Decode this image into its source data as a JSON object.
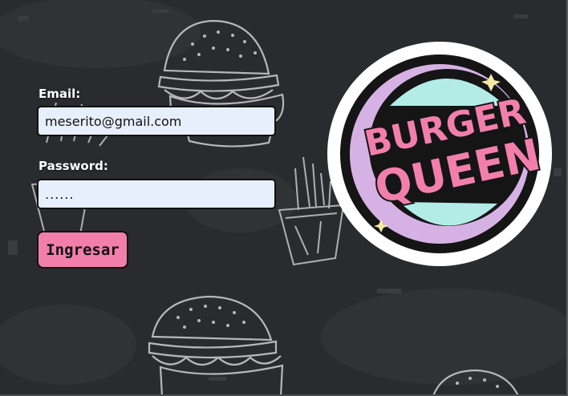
{
  "form": {
    "email_label": "Email:",
    "email_value": "meserito@gmail.com",
    "password_label": "Password:",
    "password_value": "......",
    "submit_label": "Ingresar"
  },
  "logo": {
    "line1": "BURGER",
    "line2": "QUEEN"
  },
  "colors": {
    "background": "#2a2b2e",
    "accent_pink": "#f27fab",
    "input_bg": "#e8effc",
    "logo_mint": "#b3ece6",
    "logo_lilac": "#d6b2e4"
  },
  "icons": [
    "burger-icon",
    "fries-icon",
    "logo-badge"
  ]
}
